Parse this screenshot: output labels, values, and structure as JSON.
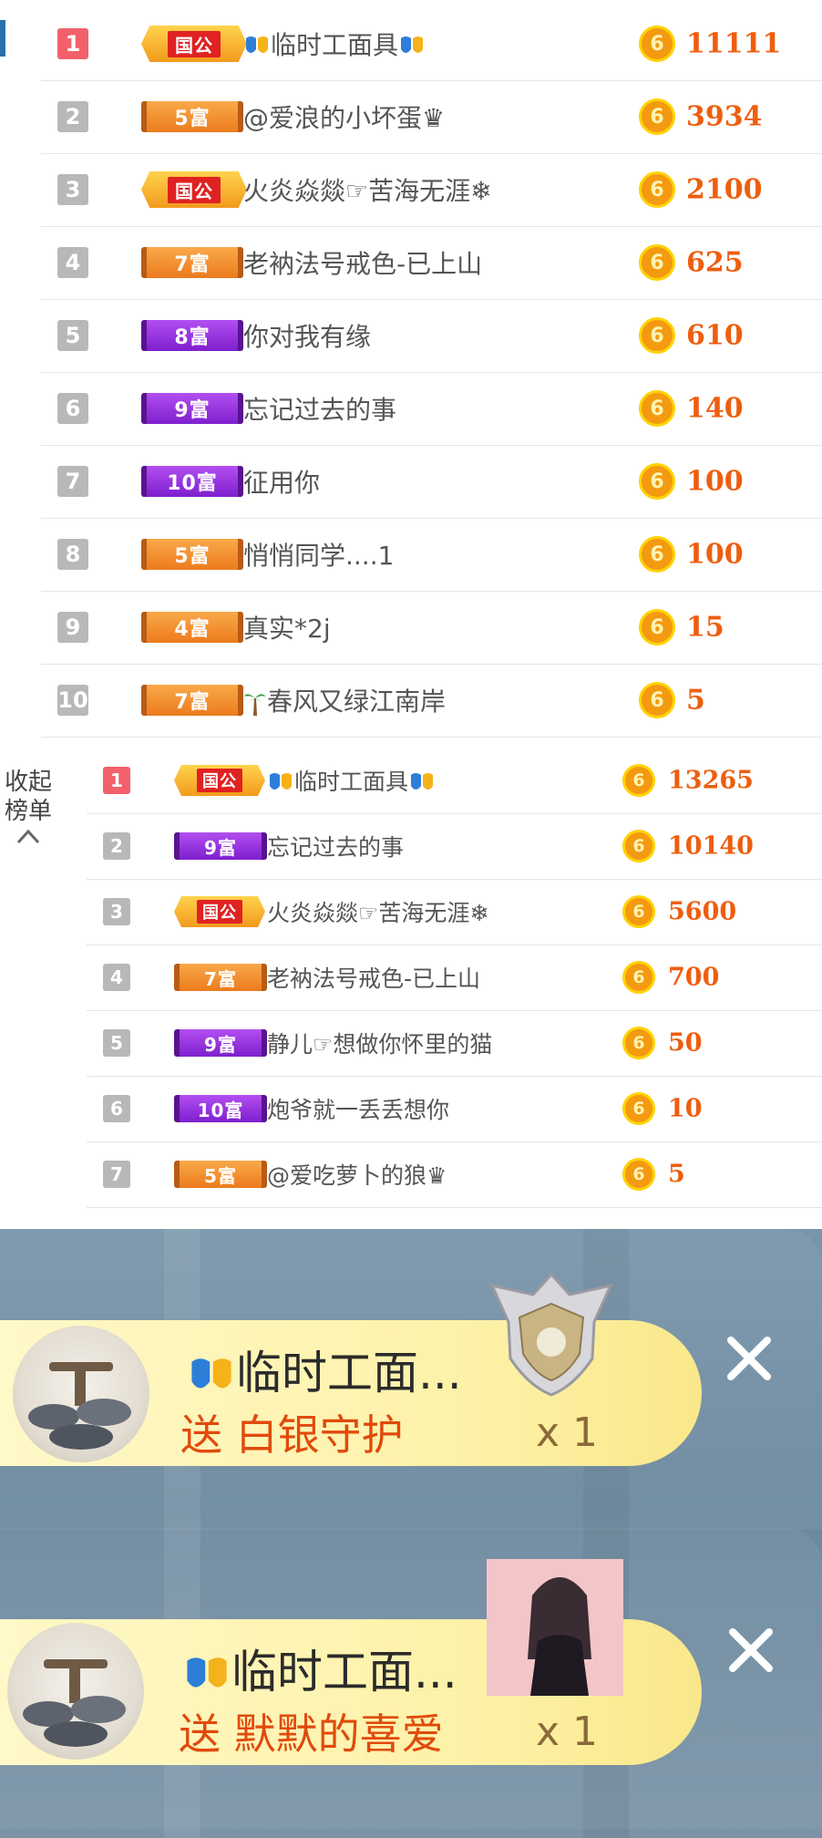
{
  "board1": {
    "rows": [
      {
        "rank": "1",
        "badge": "国公",
        "type": "national",
        "name": "临时工面具",
        "mask": true,
        "score": "11111"
      },
      {
        "rank": "2",
        "badge": "5富",
        "type": "orange",
        "name": "@爱浪的小坏蛋♛",
        "score": "3934"
      },
      {
        "rank": "3",
        "badge": "国公",
        "type": "national",
        "name": "火炎焱燚☞苦海无涯❄",
        "score": "2100"
      },
      {
        "rank": "4",
        "badge": "7富",
        "type": "orange",
        "name": "老衲法号戒色-已上山",
        "score": "625"
      },
      {
        "rank": "5",
        "badge": "8富",
        "type": "purple",
        "name": "你对我有缘",
        "score": "610"
      },
      {
        "rank": "6",
        "badge": "9富",
        "type": "purple",
        "name": "忘记过去的事",
        "score": "140"
      },
      {
        "rank": "7",
        "badge": "10富",
        "type": "purple",
        "name": "征用你",
        "score": "100"
      },
      {
        "rank": "8",
        "badge": "5富",
        "type": "orange",
        "name": "悄悄同学....1",
        "score": "100"
      },
      {
        "rank": "9",
        "badge": "4富",
        "type": "orange",
        "name": "真实*2j",
        "score": "15"
      },
      {
        "rank": "10",
        "badge": "7富",
        "type": "orange",
        "name": "春风又绿江南岸",
        "palm": true,
        "score": "5"
      }
    ]
  },
  "board2": {
    "side_label_1": "收起",
    "side_label_2": "榜单",
    "rows": [
      {
        "rank": "1",
        "badge": "国公",
        "type": "national",
        "name": "临时工面具",
        "mask": true,
        "score": "13265"
      },
      {
        "rank": "2",
        "badge": "9富",
        "type": "purple",
        "name": "忘记过去的事",
        "score": "10140"
      },
      {
        "rank": "3",
        "badge": "国公",
        "type": "national",
        "name": "火炎焱燚☞苦海无涯❄",
        "score": "5600"
      },
      {
        "rank": "4",
        "badge": "7富",
        "type": "orange",
        "name": "老衲法号戒色-已上山",
        "score": "700"
      },
      {
        "rank": "5",
        "badge": "9富",
        "type": "purple",
        "name": "静儿☞想做你怀里的猫",
        "score": "50"
      },
      {
        "rank": "6",
        "badge": "10富",
        "type": "purple",
        "name": "炮爷就一丢丢想你",
        "score": "10"
      },
      {
        "rank": "7",
        "badge": "5富",
        "type": "orange",
        "name": "@爱吃萝卜的狼♛",
        "score": "5"
      }
    ]
  },
  "coin_glyph": "6",
  "gifts": [
    {
      "user": "临时工面...",
      "action": "送 白银守护",
      "count": "x 1"
    },
    {
      "user": "临时工面...",
      "action": "送 默默的喜爱",
      "count": "x 1"
    }
  ]
}
